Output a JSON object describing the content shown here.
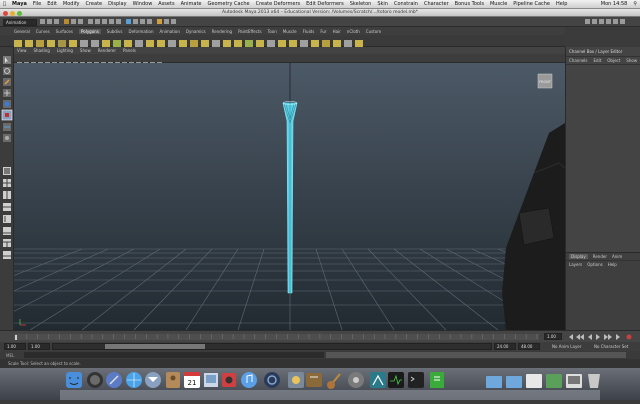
{
  "macmenu": {
    "app": "Maya",
    "items": [
      "File",
      "Edit",
      "Modify",
      "Create",
      "Display",
      "Window",
      "Assets",
      "Animate",
      "Geometry Cache",
      "Create Deformers",
      "Edit Deformers",
      "Skeleton",
      "Skin",
      "Constrain",
      "Character",
      "Bonus Tools",
      "Muscle",
      "Pipeline Cache",
      "Help"
    ],
    "clock": "Mon 14:58"
  },
  "window": {
    "title": "Autodesk Maya 2013 x64 – Educational Version: /Volumes/Scratch/.../totoro model.mb*"
  },
  "toolbar": {
    "mode": "Animation"
  },
  "shelf": {
    "tabs": [
      "General",
      "Curves",
      "Surfaces",
      "Polygons",
      "Subdivs",
      "Deformation",
      "Animation",
      "Dynamics",
      "Rendering",
      "PaintEffects",
      "Toon",
      "Muscle",
      "Fluids",
      "Fur",
      "Hair",
      "nCloth",
      "Custom"
    ],
    "active": "Polygons"
  },
  "panel": {
    "menus": [
      "View",
      "Shading",
      "Lighting",
      "Show",
      "Renderer",
      "Panels"
    ],
    "view_cube": "FRONT"
  },
  "channel_box": {
    "title": "Channel Box / Layer Editor",
    "menus": [
      "Channels",
      "Edit",
      "Object",
      "Show"
    ],
    "layer_tabs": [
      "Display",
      "Render",
      "Anim"
    ],
    "layer_menus": [
      "Layers",
      "Options",
      "Help"
    ]
  },
  "time": {
    "ticks": [
      "1",
      "5",
      "10",
      "15",
      "20",
      "25",
      "30",
      "35",
      "40",
      "45",
      "50",
      "55",
      "60",
      "65",
      "70",
      "75",
      "80",
      "85",
      "90",
      "95",
      "100",
      "105",
      "110",
      "115",
      "120",
      "125",
      "130",
      "135",
      "140",
      "145",
      "150",
      "155",
      "160",
      "165",
      "170",
      "175",
      "180",
      "185",
      "190",
      "195",
      "200",
      "205",
      "210",
      "215",
      "220",
      "225",
      "230",
      "235",
      "240"
    ],
    "current": "1.00"
  },
  "range": {
    "start": "1.00",
    "inner_start": "1.00",
    "inner_end": "24.00",
    "end": "48.00",
    "anim_layer": "No Anim Layer",
    "char_set": "No Character Set"
  },
  "mel": {
    "label": "MEL"
  },
  "help": {
    "text": "Scale Tool: Select an object to scale."
  },
  "dock": {
    "badge": "21"
  },
  "colors": {
    "accent": "#5ad0e6",
    "viewport_top": "#4c5966",
    "viewport_bottom": "#222a31",
    "object": "#1c1c1c"
  }
}
